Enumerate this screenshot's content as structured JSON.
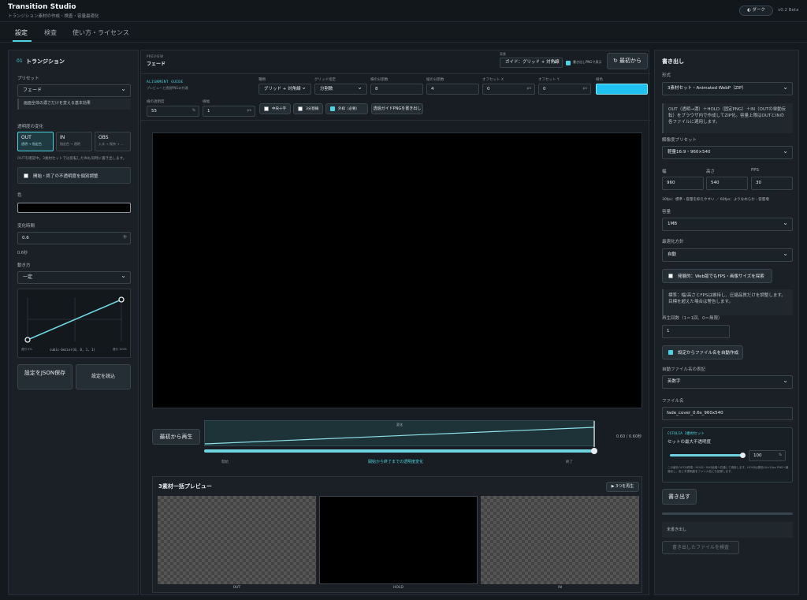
{
  "app": {
    "title": "Transition Studio",
    "subtitle": "トランジション素材の作成・検査・容量最適化",
    "theme_button": "◐ ダーク",
    "version": "v0.2 Beta"
  },
  "tabs": [
    "設定",
    "検査",
    "使い方・ライセンス"
  ],
  "left": {
    "section_num": "01",
    "section_title": "トランジション",
    "preset_label": "プリセット",
    "preset_value": "フェード",
    "preset_note": "画面全体の濃さだけを変える基本効果",
    "opacity_label": "透明度の変化",
    "modes": [
      {
        "title": "OUT",
        "sub": "透明 → 指定色"
      },
      {
        "title": "IN",
        "sub": "指定色 → 透明"
      },
      {
        "title": "OBS",
        "sub": "入る → 保持 → …"
      }
    ],
    "modes_note": "OUTを確認中。3素材セットでは反転したINも同時に書き出します。",
    "individual_check": "開始・終了の不透明度を個別調整",
    "color_label": "色",
    "duration_label": "変化時間",
    "duration_value": "0.6",
    "duration_unit": "秒",
    "duration_display": "0.6秒",
    "motion_label": "動き方",
    "motion_value": "一定",
    "curve_start": "進行 0%",
    "curve_formula": "cubic-bezier(0, 0, 1, 1)",
    "curve_end": "進行 100%",
    "save_json": "設定をJSON保存",
    "load_settings": "設定を読込"
  },
  "preview": {
    "eyebrow": "PREVIEW",
    "title": "フェード",
    "bg_label": "背景",
    "bg_value": "ガイド：グリッド + 対角線",
    "export_check": "書き出しPNGで表示",
    "reset_button": "↻ 最初から",
    "guide_title": "ALIGNMENT GUIDE",
    "guide_sub": "プレビューと透過PNGの共通",
    "guide_fields": [
      {
        "label": "種類",
        "value": "グリッド + 対角線"
      },
      {
        "label": "グリッド指定",
        "value": "分割数"
      },
      {
        "label": "横の分割数",
        "value": "8"
      },
      {
        "label": "縦の分割数",
        "value": "4"
      },
      {
        "label": "オフセット X",
        "value": "0",
        "unit": "px"
      },
      {
        "label": "オフセット Y",
        "value": "0",
        "unit": "px"
      },
      {
        "label": "線色",
        "value": ""
      }
    ],
    "opacity_field": {
      "label": "線の透明度",
      "value": "55",
      "unit": "%"
    },
    "width_field": {
      "label": "線幅",
      "value": "1",
      "unit": "px"
    },
    "toggles": [
      "中央十字",
      "3分割線",
      "外枠（必要）"
    ],
    "export_guide_button": "透過ガイドPNGを書き出し",
    "replay_button": "最初から再生",
    "timeline_label": "変化",
    "time_readout": "0.60 / 0.60秒",
    "range_start": "開始",
    "range_middle": "開始から終了までの透明度変化",
    "range_end": "終了",
    "progress": 1.0
  },
  "batch": {
    "title": "3素材一括プレビュー",
    "play_button": "▶ 3つを再生",
    "labels": [
      "OUT",
      "HOLD",
      "IN"
    ]
  },
  "export": {
    "title": "書き出し",
    "format_label": "形式",
    "format_value": "3素材セット・Animated WebP（ZIP）",
    "format_note": "OUT（透明→濃）＋HOLD（固定PNG）＋IN（OUTの単動反転）をブラウザ内で作成してZIP化。容量上限はOUTとINの各ファイルに適用します。",
    "resolution_label": "解像度プリセット",
    "resolution_value": "軽量16:9・960×540",
    "width_label": "幅",
    "width_value": "960",
    "height_label": "高さ",
    "height_value": "540",
    "fps_label": "FPS",
    "fps_value": "30",
    "fps_note": "30fps：標準・容量を抑えやすい ／ 60fps：よりなめらか・容量増",
    "capacity_label": "容量",
    "capacity_value": "1MB",
    "optimize_label": "最適化方針",
    "optimize_value": "自動",
    "aggressive_check": "発展的：Web版でもFPS・画像サイズを探索",
    "standard_note": "標準：幅/高さとFPSは維持し、圧縮品質だけを調整します。目標を超えた場合は警告します。",
    "loop_label": "再生回数（1＝1回、0＝無限）",
    "loop_value": "1",
    "auto_name_check": "設定からファイル名を自動作成",
    "auto_name_label": "自動ファイル名の表記",
    "auto_name_value": "英数字",
    "filename_label": "ファイル名",
    "filename_value": "fade_cover_0.6s_960x540",
    "ccfolia_title": "CCFOLIA 3素材セット",
    "ccfolia_label": "セットの最大不透明度",
    "ccfolia_value": "100",
    "ccfolia_unit": "%",
    "ccfolia_fraction": 1.0,
    "ccfolia_note": "この値をOUTの終端・HOLD・INの始端へ共通して適用します。HOLDは基色10×10px PNGへ最適化し、色と不透明度をファイル名にも記録します。",
    "export_button": "書き出す",
    "status": "未書き出し",
    "inspect_button": "書き出したファイルを検査"
  },
  "colors": {
    "accent": "#4fd1e0",
    "guide_line": "#1ec1ef",
    "fill": "#000000"
  }
}
